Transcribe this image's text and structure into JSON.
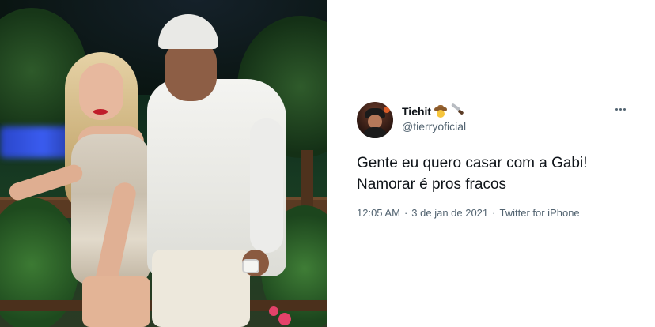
{
  "tweet": {
    "display_name": "Tiehit",
    "name_emojis": [
      "cowboy-hat-face",
      "kitchen-knife"
    ],
    "handle": "@tierryoficial",
    "text_lines": [
      "Gente eu quero casar com a Gabi!",
      "Namorar é pros fracos"
    ],
    "time": "12:05 AM",
    "separator": "·",
    "date": "3 de jan de 2021",
    "source": "Twitter for iPhone"
  },
  "icons": {
    "more": "more-dots-icon"
  }
}
